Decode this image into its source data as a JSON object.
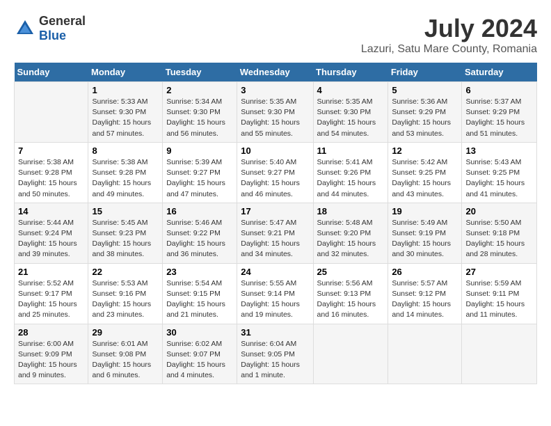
{
  "logo": {
    "general": "General",
    "blue": "Blue"
  },
  "title": "July 2024",
  "subtitle": "Lazuri, Satu Mare County, Romania",
  "header": {
    "days": [
      "Sunday",
      "Monday",
      "Tuesday",
      "Wednesday",
      "Thursday",
      "Friday",
      "Saturday"
    ]
  },
  "weeks": [
    {
      "days": [
        {
          "num": "",
          "info": ""
        },
        {
          "num": "1",
          "info": "Sunrise: 5:33 AM\nSunset: 9:30 PM\nDaylight: 15 hours\nand 57 minutes."
        },
        {
          "num": "2",
          "info": "Sunrise: 5:34 AM\nSunset: 9:30 PM\nDaylight: 15 hours\nand 56 minutes."
        },
        {
          "num": "3",
          "info": "Sunrise: 5:35 AM\nSunset: 9:30 PM\nDaylight: 15 hours\nand 55 minutes."
        },
        {
          "num": "4",
          "info": "Sunrise: 5:35 AM\nSunset: 9:30 PM\nDaylight: 15 hours\nand 54 minutes."
        },
        {
          "num": "5",
          "info": "Sunrise: 5:36 AM\nSunset: 9:29 PM\nDaylight: 15 hours\nand 53 minutes."
        },
        {
          "num": "6",
          "info": "Sunrise: 5:37 AM\nSunset: 9:29 PM\nDaylight: 15 hours\nand 51 minutes."
        }
      ]
    },
    {
      "days": [
        {
          "num": "7",
          "info": "Sunrise: 5:38 AM\nSunset: 9:28 PM\nDaylight: 15 hours\nand 50 minutes."
        },
        {
          "num": "8",
          "info": "Sunrise: 5:38 AM\nSunset: 9:28 PM\nDaylight: 15 hours\nand 49 minutes."
        },
        {
          "num": "9",
          "info": "Sunrise: 5:39 AM\nSunset: 9:27 PM\nDaylight: 15 hours\nand 47 minutes."
        },
        {
          "num": "10",
          "info": "Sunrise: 5:40 AM\nSunset: 9:27 PM\nDaylight: 15 hours\nand 46 minutes."
        },
        {
          "num": "11",
          "info": "Sunrise: 5:41 AM\nSunset: 9:26 PM\nDaylight: 15 hours\nand 44 minutes."
        },
        {
          "num": "12",
          "info": "Sunrise: 5:42 AM\nSunset: 9:25 PM\nDaylight: 15 hours\nand 43 minutes."
        },
        {
          "num": "13",
          "info": "Sunrise: 5:43 AM\nSunset: 9:25 PM\nDaylight: 15 hours\nand 41 minutes."
        }
      ]
    },
    {
      "days": [
        {
          "num": "14",
          "info": "Sunrise: 5:44 AM\nSunset: 9:24 PM\nDaylight: 15 hours\nand 39 minutes."
        },
        {
          "num": "15",
          "info": "Sunrise: 5:45 AM\nSunset: 9:23 PM\nDaylight: 15 hours\nand 38 minutes."
        },
        {
          "num": "16",
          "info": "Sunrise: 5:46 AM\nSunset: 9:22 PM\nDaylight: 15 hours\nand 36 minutes."
        },
        {
          "num": "17",
          "info": "Sunrise: 5:47 AM\nSunset: 9:21 PM\nDaylight: 15 hours\nand 34 minutes."
        },
        {
          "num": "18",
          "info": "Sunrise: 5:48 AM\nSunset: 9:20 PM\nDaylight: 15 hours\nand 32 minutes."
        },
        {
          "num": "19",
          "info": "Sunrise: 5:49 AM\nSunset: 9:19 PM\nDaylight: 15 hours\nand 30 minutes."
        },
        {
          "num": "20",
          "info": "Sunrise: 5:50 AM\nSunset: 9:18 PM\nDaylight: 15 hours\nand 28 minutes."
        }
      ]
    },
    {
      "days": [
        {
          "num": "21",
          "info": "Sunrise: 5:52 AM\nSunset: 9:17 PM\nDaylight: 15 hours\nand 25 minutes."
        },
        {
          "num": "22",
          "info": "Sunrise: 5:53 AM\nSunset: 9:16 PM\nDaylight: 15 hours\nand 23 minutes."
        },
        {
          "num": "23",
          "info": "Sunrise: 5:54 AM\nSunset: 9:15 PM\nDaylight: 15 hours\nand 21 minutes."
        },
        {
          "num": "24",
          "info": "Sunrise: 5:55 AM\nSunset: 9:14 PM\nDaylight: 15 hours\nand 19 minutes."
        },
        {
          "num": "25",
          "info": "Sunrise: 5:56 AM\nSunset: 9:13 PM\nDaylight: 15 hours\nand 16 minutes."
        },
        {
          "num": "26",
          "info": "Sunrise: 5:57 AM\nSunset: 9:12 PM\nDaylight: 15 hours\nand 14 minutes."
        },
        {
          "num": "27",
          "info": "Sunrise: 5:59 AM\nSunset: 9:11 PM\nDaylight: 15 hours\nand 11 minutes."
        }
      ]
    },
    {
      "days": [
        {
          "num": "28",
          "info": "Sunrise: 6:00 AM\nSunset: 9:09 PM\nDaylight: 15 hours\nand 9 minutes."
        },
        {
          "num": "29",
          "info": "Sunrise: 6:01 AM\nSunset: 9:08 PM\nDaylight: 15 hours\nand 6 minutes."
        },
        {
          "num": "30",
          "info": "Sunrise: 6:02 AM\nSunset: 9:07 PM\nDaylight: 15 hours\nand 4 minutes."
        },
        {
          "num": "31",
          "info": "Sunrise: 6:04 AM\nSunset: 9:05 PM\nDaylight: 15 hours\nand 1 minute."
        },
        {
          "num": "",
          "info": ""
        },
        {
          "num": "",
          "info": ""
        },
        {
          "num": "",
          "info": ""
        }
      ]
    }
  ]
}
